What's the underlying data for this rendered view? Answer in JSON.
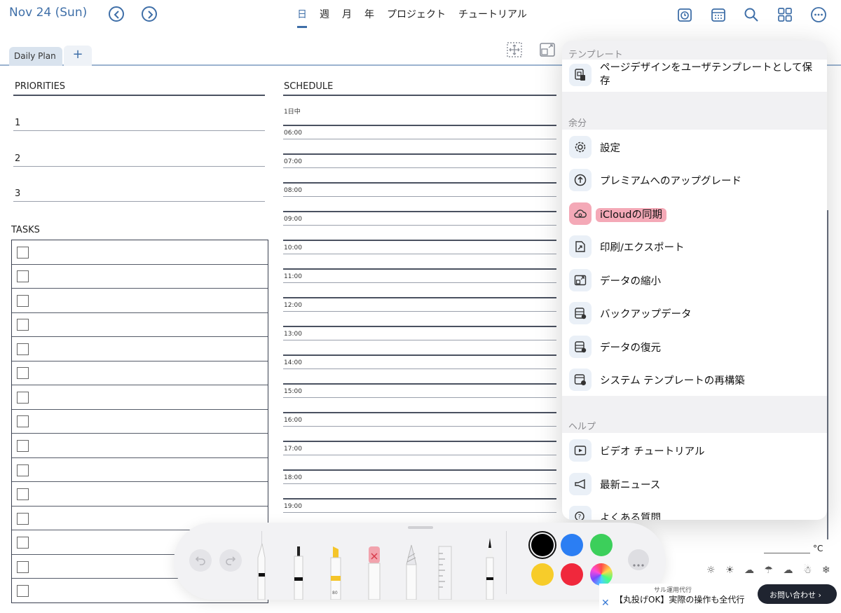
{
  "header": {
    "date": "Nov 24 (Sun)",
    "view_tabs": [
      {
        "label": "日",
        "active": true
      },
      {
        "label": "週",
        "active": false
      },
      {
        "label": "月",
        "active": false
      },
      {
        "label": "年",
        "active": false
      },
      {
        "label": "プロジェクト",
        "active": false
      },
      {
        "label": "チュートリアル",
        "active": false
      }
    ],
    "icons": [
      "clock-calendar-icon",
      "calendar-icon",
      "search-icon",
      "grid-icon",
      "more-icon"
    ]
  },
  "tabs": {
    "current": "Daily Plan",
    "add": "+"
  },
  "planner": {
    "priorities_title": "PRIORITIES",
    "priorities": [
      "1",
      "2",
      "3"
    ],
    "tasks_title": "TASKS",
    "task_count": 15,
    "schedule_title": "SCHEDULE",
    "all_day": "1日中",
    "times": [
      "06:00",
      "07:00",
      "08:00",
      "09:00",
      "10:00",
      "11:00",
      "12:00",
      "13:00",
      "14:00",
      "15:00",
      "16:00",
      "17:00",
      "18:00",
      "19:00"
    ],
    "temp_unit": "°C",
    "weather": "☼ ☀ ☁ ☂ ☁ ☃ ❄"
  },
  "menu": {
    "template_header": "テンプレート",
    "template_items": [
      {
        "label": "ページデザインをユーザテンプレートとして保存",
        "icon": "save-template-icon"
      }
    ],
    "extra_header": "余分",
    "extra_items": [
      {
        "label": "設定",
        "icon": "gear-icon"
      },
      {
        "label": "プレミアムへのアップグレード",
        "icon": "upgrade-icon"
      },
      {
        "label": "iCloudの同期",
        "icon": "cloud-sync-icon",
        "highlighted": true
      },
      {
        "label": "印刷/エクスポート",
        "icon": "export-icon"
      },
      {
        "label": "データの縮小",
        "icon": "shrink-icon"
      },
      {
        "label": "バックアップデータ",
        "icon": "backup-icon"
      },
      {
        "label": "データの復元",
        "icon": "restore-icon"
      },
      {
        "label": "システム テンプレートの再構築",
        "icon": "rebuild-icon"
      }
    ],
    "help_header": "ヘルプ",
    "help_items": [
      {
        "label": "ビデオ チュートリアル",
        "icon": "video-icon"
      },
      {
        "label": "最新ニュース",
        "icon": "megaphone-icon"
      },
      {
        "label": "よくある質問",
        "icon": "faq-icon"
      }
    ]
  },
  "toolbar": {
    "pencil_size": "80",
    "colors": [
      "#000000",
      "#2b7ef3",
      "#3ccf5b",
      "#f7cc2a",
      "#f0283c",
      "multicolor"
    ],
    "selected_color": "#000000"
  },
  "ad": {
    "small": "サル運用代行",
    "text": "【丸投げOK】実際の操作も全代行",
    "button": "お問い合わせ ›",
    "close": "✕"
  }
}
